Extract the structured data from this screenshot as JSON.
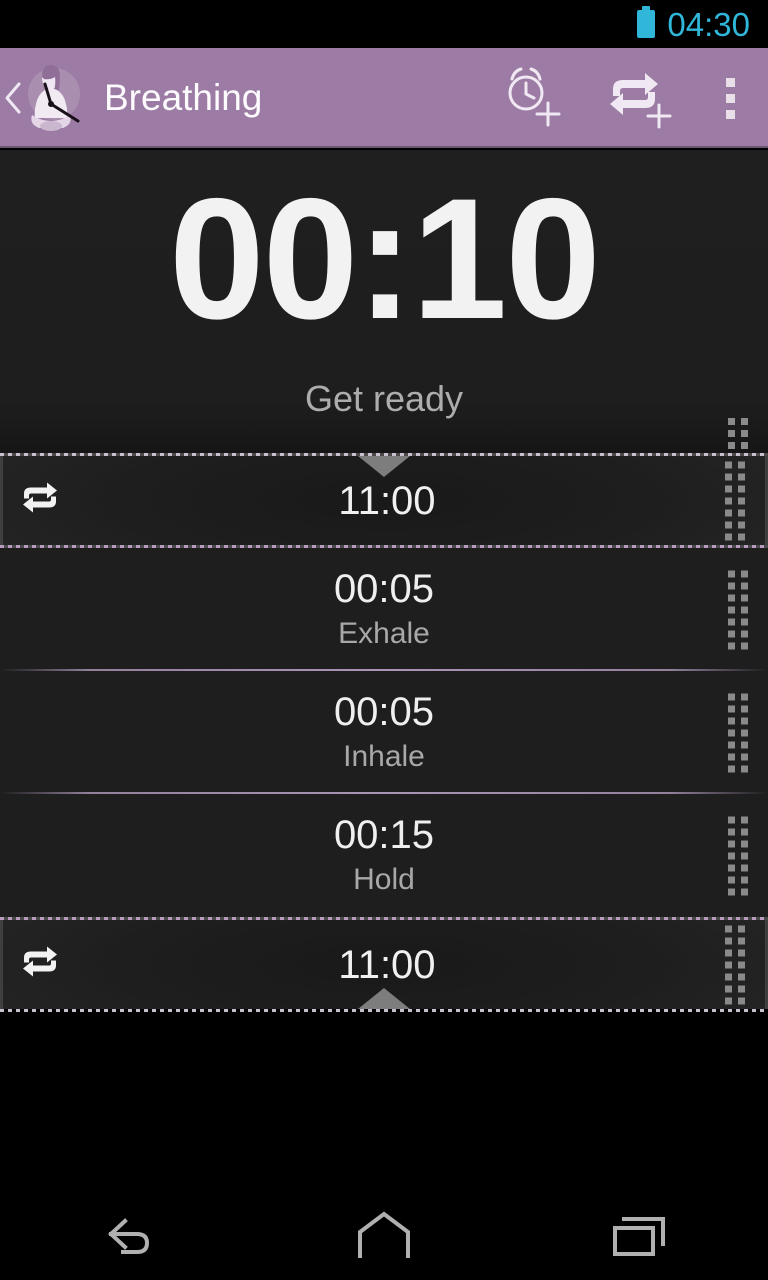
{
  "status_bar": {
    "clock": "04:30",
    "battery_icon": "battery-icon",
    "accent_color": "#2fb6d8"
  },
  "action_bar": {
    "title": "Breathing",
    "background_color": "#9c7ca4",
    "up_icon": "back-caret-icon",
    "app_icon": "meditation-clock-icon",
    "actions": [
      {
        "name": "add-timer-button",
        "icon": "alarm-clock-plus-icon",
        "label": "Add timer"
      },
      {
        "name": "add-loop-button",
        "icon": "repeat-plus-icon",
        "label": "Add loop"
      },
      {
        "name": "overflow-menu-button",
        "icon": "more-vertical-icon",
        "label": "More options"
      }
    ]
  },
  "timer": {
    "value": "00:10",
    "status": "Get ready",
    "handle_icon": "drag-handle-icon"
  },
  "list": {
    "rows": [
      {
        "type": "loop-start",
        "time": "11:00",
        "label": "",
        "icon": "repeat-icon",
        "handle_icon": "drag-handle-icon",
        "marker": "triangle-down"
      },
      {
        "type": "interval",
        "time": "00:05",
        "label": "Exhale",
        "handle_icon": "drag-handle-icon"
      },
      {
        "type": "interval",
        "time": "00:05",
        "label": "Inhale",
        "handle_icon": "drag-handle-icon"
      },
      {
        "type": "interval",
        "time": "00:15",
        "label": "Hold",
        "handle_icon": "drag-handle-icon"
      },
      {
        "type": "loop-end",
        "time": "11:00",
        "label": "",
        "icon": "repeat-icon",
        "handle_icon": "drag-handle-icon",
        "marker": "triangle-up"
      }
    ]
  },
  "nav_bar": {
    "buttons": [
      {
        "name": "nav-back-button",
        "icon": "back-arrow-icon"
      },
      {
        "name": "nav-home-button",
        "icon": "home-icon"
      },
      {
        "name": "nav-recents-button",
        "icon": "recents-icon"
      }
    ]
  }
}
